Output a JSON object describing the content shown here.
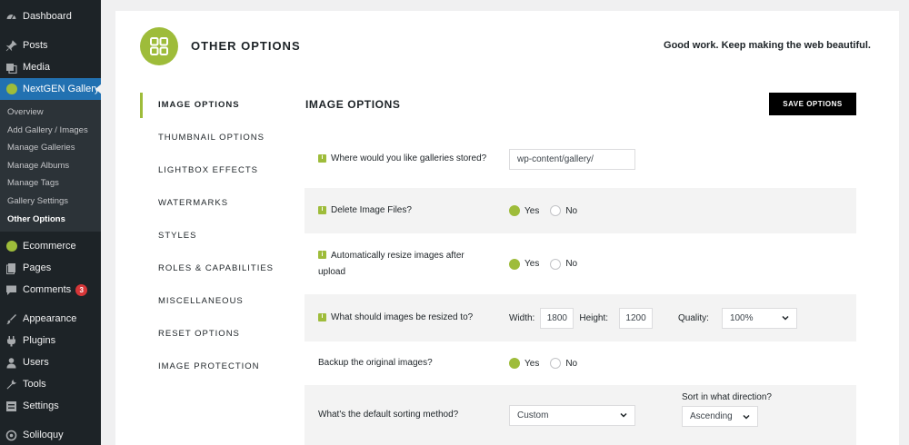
{
  "sidebar": {
    "top_items": [
      {
        "label": "Dashboard",
        "icon": "dashboard-icon"
      },
      {
        "label": "Posts",
        "icon": "pin-icon"
      },
      {
        "label": "Media",
        "icon": "media-icon"
      }
    ],
    "active_item": {
      "label": "NextGEN Gallery",
      "icon": "nextgen-icon"
    },
    "submenu": [
      "Overview",
      "Add Gallery / Images",
      "Manage Galleries",
      "Manage Albums",
      "Manage Tags",
      "Gallery Settings",
      "Other Options"
    ],
    "bottom_items": [
      {
        "label": "Ecommerce",
        "icon": "ecommerce-icon"
      },
      {
        "label": "Pages",
        "icon": "pages-icon"
      },
      {
        "label": "Comments",
        "icon": "comments-icon",
        "badge": "3"
      },
      {
        "label": "Appearance",
        "icon": "appearance-icon"
      },
      {
        "label": "Plugins",
        "icon": "plugins-icon"
      },
      {
        "label": "Users",
        "icon": "users-icon"
      },
      {
        "label": "Tools",
        "icon": "tools-icon"
      },
      {
        "label": "Settings",
        "icon": "settings-icon"
      },
      {
        "label": "Soliloquy",
        "icon": "soliloquy-icon"
      }
    ]
  },
  "header": {
    "title": "OTHER OPTIONS",
    "tagline": "Good work. Keep making the web beautiful."
  },
  "nav": [
    "IMAGE OPTIONS",
    "THUMBNAIL OPTIONS",
    "LIGHTBOX EFFECTS",
    "WATERMARKS",
    "STYLES",
    "ROLES & CAPABILITIES",
    "MISCELLANEOUS",
    "RESET OPTIONS",
    "IMAGE PROTECTION"
  ],
  "section": {
    "title": "IMAGE OPTIONS",
    "save_label": "SAVE OPTIONS"
  },
  "options": {
    "gallery_path": {
      "label": "Where would you like galleries stored?",
      "value": "wp-content/gallery/"
    },
    "delete_files": {
      "label": "Delete Image Files?",
      "yes": "Yes",
      "no": "No"
    },
    "auto_resize": {
      "label": "Automatically resize images after upload",
      "yes": "Yes",
      "no": "No"
    },
    "resize_to": {
      "label": "What should images be resized to?",
      "width_label": "Width:",
      "width": "1800",
      "height_label": "Height:",
      "height": "1200",
      "quality_label": "Quality:",
      "quality": "100%"
    },
    "backup": {
      "label": "Backup the original images?",
      "yes": "Yes",
      "no": "No"
    },
    "sorting": {
      "label": "What's the default sorting method?",
      "value": "Custom",
      "direction_label": "Sort in what direction?",
      "direction": "Ascending"
    }
  },
  "colors": {
    "accent": "#9ebc3a",
    "wp_blue": "#2271b1",
    "sidebar": "#1d2327"
  }
}
